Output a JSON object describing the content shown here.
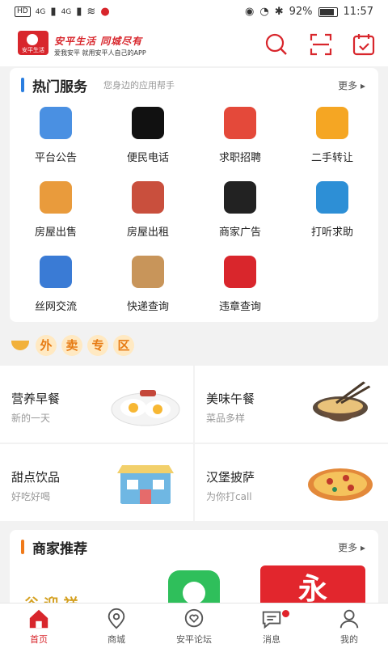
{
  "status_bar": {
    "carrier_badge": "HD",
    "signal1": "4G",
    "signal2": "4G",
    "battery": "92%",
    "time": "11:57"
  },
  "header": {
    "brand_title": "安平生活 同城尽有",
    "brand_sub": "爱我安平  就用安平人自己的APP",
    "logo_text": "安平生活"
  },
  "hot_services": {
    "title": "热门服务",
    "subtitle": "您身边的应用帮手",
    "more": "更多 ▸",
    "items": [
      {
        "label": "平台公告",
        "icon": "news-icon",
        "color": "#4a90e2"
      },
      {
        "label": "便民电话",
        "icon": "phone-icon",
        "color": "#111111"
      },
      {
        "label": "求职招聘",
        "icon": "job-icon",
        "color": "#e4493a"
      },
      {
        "label": "二手转让",
        "icon": "secondhand-icon",
        "color": "#f5a623"
      },
      {
        "label": "房屋出售",
        "icon": "house-sale-icon",
        "color": "#e99b3c"
      },
      {
        "label": "房屋出租",
        "icon": "house-rent-icon",
        "color": "#c94f3d"
      },
      {
        "label": "商家广告",
        "icon": "bomb-ad-icon",
        "color": "#222222"
      },
      {
        "label": "打听求助",
        "icon": "help-book-icon",
        "color": "#2d8fd6"
      },
      {
        "label": "丝网交流",
        "icon": "wire-mesh-icon",
        "color": "#3a7bd5"
      },
      {
        "label": "快递查询",
        "icon": "panda-delivery-icon",
        "color": "#c8955a"
      },
      {
        "label": "违章查询",
        "icon": "car-icon",
        "color": "#d9262c"
      }
    ]
  },
  "takeaway": {
    "chars": [
      "外",
      "卖",
      "专",
      "区"
    ],
    "items": [
      {
        "title": "营养早餐",
        "sub": "新的一天",
        "icon": "breakfast-eggs-icon",
        "color": "#f7b733"
      },
      {
        "title": "美味午餐",
        "sub": "菜品多样",
        "icon": "lunch-noodles-icon",
        "color": "#6b4f3a"
      },
      {
        "title": "甜点饮品",
        "sub": "好吃好喝",
        "icon": "drinks-shop-icon",
        "color": "#6fb7e3"
      },
      {
        "title": "汉堡披萨",
        "sub": "为你打call",
        "icon": "pizza-icon",
        "color": "#e3893a"
      }
    ]
  },
  "merchants": {
    "title": "商家推荐",
    "more": "更多 ▸",
    "partial_text": "谷 迎 祥"
  },
  "tabs": [
    {
      "label": "首页",
      "icon": "home-icon",
      "active": true
    },
    {
      "label": "商城",
      "icon": "map-pin-icon",
      "active": false
    },
    {
      "label": "安平论坛",
      "icon": "heart-chat-icon",
      "active": false
    },
    {
      "label": "消息",
      "icon": "message-icon",
      "active": false,
      "badge": true
    },
    {
      "label": "我的",
      "icon": "user-icon",
      "active": false
    }
  ],
  "colors": {
    "brand": "#d8262c",
    "section_blue": "#2a7ee0",
    "section_orange": "#f07a1a"
  }
}
